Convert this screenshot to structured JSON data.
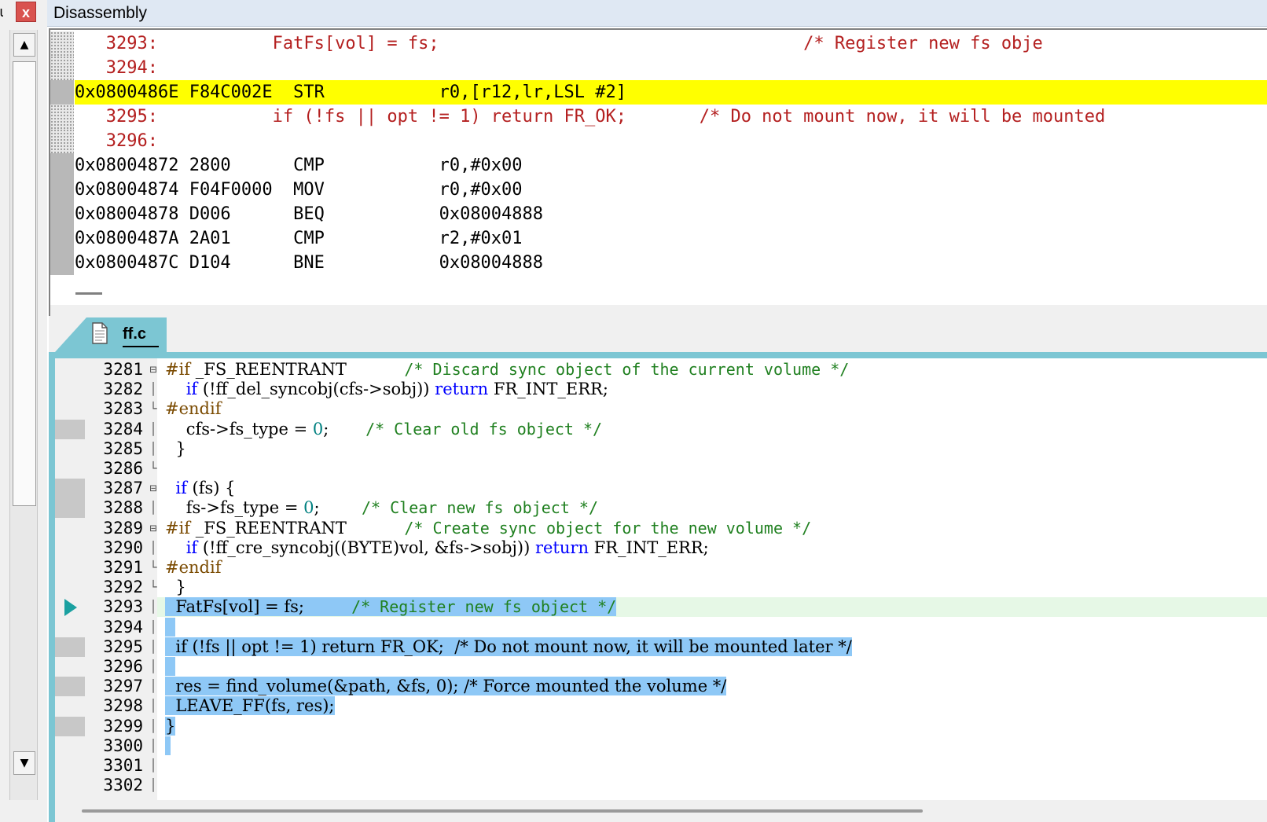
{
  "window": {
    "title": "Disassembly",
    "pin_glyph": "ɩ",
    "close_glyph": "x",
    "accent": "#7cc6d3",
    "current_instruction_color": "#ffff00",
    "selection_color": "#8ec8f6"
  },
  "scrollbar": {
    "up_glyph": "▲",
    "down_glyph": "▼"
  },
  "disassembly": {
    "rows": [
      {
        "kind": "src",
        "text": "   3293:           FatFs[vol] = fs;                                   /* Register new fs obje"
      },
      {
        "kind": "src",
        "text": "   3294:"
      },
      {
        "kind": "asm",
        "current": true,
        "text": "0x0800486E F84C002E  STR           r0,[r12,lr,LSL #2]"
      },
      {
        "kind": "src",
        "text": "   3295:           if (!fs || opt != 1) return FR_OK;       /* Do not mount now, it will be mounted"
      },
      {
        "kind": "src",
        "text": "   3296:"
      },
      {
        "kind": "asm",
        "text": "0x08004872 2800      CMP           r0,#0x00"
      },
      {
        "kind": "asm",
        "text": "0x08004874 F04F0000  MOV           r0,#0x00"
      },
      {
        "kind": "asm",
        "text": "0x08004878 D006      BEQ           0x08004888"
      },
      {
        "kind": "asm",
        "text": "0x0800487A 2A01      CMP           r2,#0x01"
      },
      {
        "kind": "asm",
        "text": "0x0800487C D104      BNE           0x08004888"
      }
    ]
  },
  "editor": {
    "tab_label": "ff.c",
    "lines": [
      {
        "n": "3281",
        "fold": "⊟",
        "bp": false,
        "hl": false,
        "segs": [
          [
            "pp",
            "#if"
          ],
          [
            "t",
            " _FS_REENTRANT           "
          ],
          [
            "cm",
            "/* Discard sync object of the current volume */"
          ]
        ]
      },
      {
        "n": "3282",
        "fold": "│",
        "bp": false,
        "hl": false,
        "segs": [
          [
            "t",
            "    "
          ],
          [
            "kw",
            "if"
          ],
          [
            "t",
            " (!ff_del_syncobj(cfs->sobj)) "
          ],
          [
            "kw",
            "return"
          ],
          [
            "t",
            " FR_INT_ERR;"
          ]
        ]
      },
      {
        "n": "3283",
        "fold": "└",
        "bp": false,
        "hl": false,
        "segs": [
          [
            "pp",
            "#endif"
          ]
        ]
      },
      {
        "n": "3284",
        "fold": "│",
        "bp": true,
        "hl": false,
        "segs": [
          [
            "t",
            "    cfs->fs_type = "
          ],
          [
            "num",
            "0"
          ],
          [
            "t",
            ";       "
          ],
          [
            "cm",
            "/* Clear old fs object */"
          ]
        ]
      },
      {
        "n": "3285",
        "fold": "│",
        "bp": false,
        "hl": false,
        "segs": [
          [
            "t",
            "  }"
          ]
        ]
      },
      {
        "n": "3286",
        "fold": "└",
        "bp": false,
        "hl": false,
        "segs": [
          [
            "t",
            ""
          ]
        ]
      },
      {
        "n": "3287",
        "fold": "⊟",
        "bp": true,
        "hl": false,
        "segs": [
          [
            "t",
            "  "
          ],
          [
            "kw",
            "if"
          ],
          [
            "t",
            " (fs) {"
          ]
        ]
      },
      {
        "n": "3288",
        "fold": "│",
        "bp": true,
        "hl": false,
        "segs": [
          [
            "t",
            "    fs->fs_type = "
          ],
          [
            "num",
            "0"
          ],
          [
            "t",
            ";        "
          ],
          [
            "cm",
            "/* Clear new fs object */"
          ]
        ]
      },
      {
        "n": "3289",
        "fold": "⊟",
        "bp": false,
        "hl": false,
        "segs": [
          [
            "pp",
            "#if"
          ],
          [
            "t",
            " _FS_REENTRANT           "
          ],
          [
            "cm",
            "/* Create sync object for the new volume */"
          ]
        ]
      },
      {
        "n": "3290",
        "fold": "│",
        "bp": false,
        "hl": false,
        "segs": [
          [
            "t",
            "    "
          ],
          [
            "kw",
            "if"
          ],
          [
            "t",
            " (!ff_cre_syncobj((BYTE)vol, &fs->sobj)) "
          ],
          [
            "kw",
            "return"
          ],
          [
            "t",
            " FR_INT_ERR;"
          ]
        ]
      },
      {
        "n": "3291",
        "fold": "└",
        "bp": false,
        "hl": false,
        "segs": [
          [
            "pp",
            "#endif"
          ]
        ]
      },
      {
        "n": "3292",
        "fold": "└",
        "bp": false,
        "hl": false,
        "segs": [
          [
            "t",
            "  }"
          ]
        ]
      },
      {
        "n": "3293",
        "fold": "│",
        "bp": false,
        "hl": true,
        "current": true,
        "segs": [
          [
            "t",
            "  FatFs[vol] = fs;         "
          ],
          [
            "cm",
            "/* Register new fs object */"
          ]
        ]
      },
      {
        "n": "3294",
        "fold": "│",
        "bp": false,
        "hl": true,
        "segs": [
          [
            "t",
            "  "
          ]
        ]
      },
      {
        "n": "3295",
        "fold": "│",
        "bp": true,
        "hl": true,
        "segs": [
          [
            "t",
            "  if (!fs || opt != 1) return FR_OK;  /* Do not mount now, it will be mounted later */"
          ]
        ]
      },
      {
        "n": "3296",
        "fold": "│",
        "bp": false,
        "hl": true,
        "segs": [
          [
            "t",
            "  "
          ]
        ]
      },
      {
        "n": "3297",
        "fold": "│",
        "bp": true,
        "hl": true,
        "segs": [
          [
            "t",
            "  res = find_volume(&path, &fs, 0); /* Force mounted the volume */"
          ]
        ]
      },
      {
        "n": "3298",
        "fold": "│",
        "bp": false,
        "hl": true,
        "segs": [
          [
            "t",
            "  LEAVE_FF(fs, res);"
          ]
        ]
      },
      {
        "n": "3299",
        "fold": "│",
        "bp": true,
        "hl": true,
        "segs": [
          [
            "t",
            "}"
          ]
        ]
      },
      {
        "n": "3300",
        "fold": "│",
        "bp": false,
        "hl": true,
        "segs": [
          [
            "t",
            " "
          ]
        ]
      },
      {
        "n": "3301",
        "fold": "│",
        "bp": false,
        "hl": false,
        "segs": [
          [
            "t",
            ""
          ]
        ]
      },
      {
        "n": "3302",
        "fold": "│",
        "bp": false,
        "hl": false,
        "segs": [
          [
            "t",
            ""
          ]
        ]
      }
    ]
  }
}
